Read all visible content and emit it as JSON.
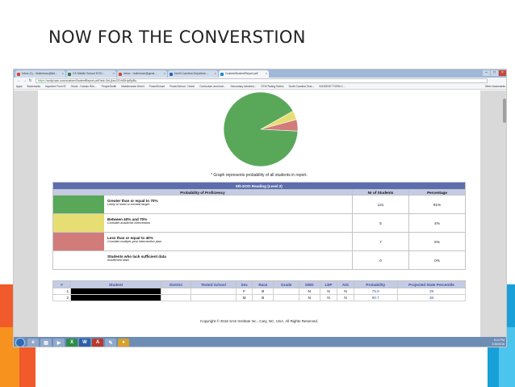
{
  "slide": {
    "title": "NOW FOR THE CONVERSTION"
  },
  "browser": {
    "tabs": [
      {
        "label": "Inbox (1) - lhollerman@kld...",
        "active": false
      },
      {
        "label": "CS Middle School EOG...",
        "active": false
      },
      {
        "label": "Inbox - hollerman@gmai...",
        "active": false
      },
      {
        "label": "North Carolina Departme...",
        "active": false
      },
      {
        "label": "CustomStudentReport.pdf",
        "active": true
      }
    ],
    "url_scheme": "https://",
    "url": "ncdpi.sas.com/customStudentReport.pdf?sid=3nLjknvCErhiDHpf0yBu...",
    "bookmarks": [
      "Apps",
      "Bookmarks",
      "Imported From IE",
      "Home - Human Res...",
      "PeopleSmith",
      "Maintenance Direct",
      "PowerSchool",
      "PowerSchool - Home",
      "Curriculum and Instr...",
      "Secondary Administ...",
      "STW Rating Rubric",
      "North Carolina Teac...",
      "INCIDENT FORM C..."
    ],
    "other_bookmarks": "Other bookmarks"
  },
  "report": {
    "pie_note": "* Graph represents probability of all students in report.",
    "title": "6th EOG Reading (Level 2)",
    "headers": [
      "Probability of Proficiency",
      "Nr of Students",
      "Percentage"
    ],
    "rows": [
      {
        "label": "Greater than or equal to 70%",
        "sub": "Likely to meet or exceed target",
        "count": "121",
        "pct": "91%",
        "color": "#59a85a"
      },
      {
        "label": "Between 40% and 70%",
        "sub": "Consider academic intervention",
        "count": "5",
        "pct": "4%",
        "color": "#e7de73"
      },
      {
        "label": "Less than or equal to 40%",
        "sub": "Consider multiple-year intervention plan",
        "count": "7",
        "pct": "5%",
        "color": "#d27b7b"
      },
      {
        "label": "Students who lack sufficient data",
        "sub": "Insufficient data",
        "count": "0",
        "pct": "0%",
        "color": "#ffffff"
      }
    ],
    "pie_values": [
      91,
      4,
      5
    ]
  },
  "students": {
    "headers": [
      "#",
      "Student",
      "District",
      "Tested School",
      "Sex",
      "Race",
      "Grade",
      "SWD",
      "LEP",
      "AIG",
      "Probability",
      "Projected State Percentile"
    ],
    "rows": [
      {
        "num": "1",
        "sex": "F",
        "race": "B",
        "swd": "N",
        "lep": "N",
        "aig": "N",
        "prob": "75.9",
        "pct": "29"
      },
      {
        "num": "2",
        "sex": "M",
        "race": "B",
        "swd": "N",
        "lep": "N",
        "aig": "N",
        "prob": "90.7",
        "pct": "38"
      }
    ]
  },
  "footer": {
    "copyright": "Copyright © 2016 SAS Institute Inc., Cary, NC, USA. All Rights Reserved."
  },
  "taskbar": {
    "icons": [
      "ie-icon",
      "explorer-icon",
      "media-icon",
      "excel-icon",
      "word-icon",
      "pdf-icon",
      "paint-icon",
      "chrome-icon"
    ],
    "time": "5:24 PM",
    "date": "2/16/2016"
  }
}
